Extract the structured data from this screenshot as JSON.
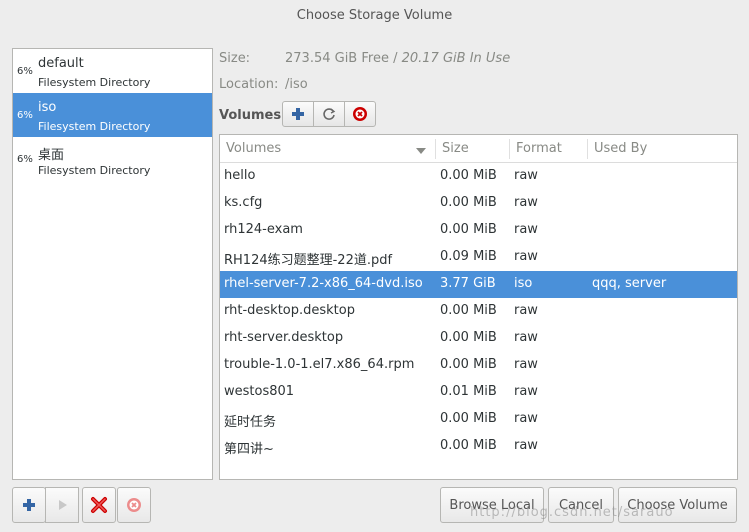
{
  "window": {
    "title": "Choose Storage Volume"
  },
  "pools": [
    {
      "percent": "6%",
      "name": "default",
      "type": "Filesystem Directory"
    },
    {
      "percent": "6%",
      "name": "iso",
      "type": "Filesystem Directory"
    },
    {
      "percent": "6%",
      "name": "桌面",
      "type": "Filesystem Directory"
    }
  ],
  "info": {
    "size_label": "Size:",
    "size_free": "273.54 GiB Free",
    "size_sep": " / ",
    "size_in_use": "20.17 GiB In Use",
    "location_label": "Location:",
    "location_value": "/iso"
  },
  "volumes_label": "Volumes",
  "table": {
    "columns": [
      "Volumes",
      "Size",
      "Format",
      "Used By"
    ],
    "rows": [
      {
        "name": "hello",
        "size": "0.00 MiB",
        "format": "raw",
        "used_by": ""
      },
      {
        "name": "ks.cfg",
        "size": "0.00 MiB",
        "format": "raw",
        "used_by": ""
      },
      {
        "name": "rh124-exam",
        "size": "0.00 MiB",
        "format": "raw",
        "used_by": ""
      },
      {
        "name": "RH124练习题整理-22道.pdf",
        "size": "0.09 MiB",
        "format": "raw",
        "used_by": ""
      },
      {
        "name": "rhel-server-7.2-x86_64-dvd.iso",
        "size": "3.77 GiB",
        "format": "iso",
        "used_by": "qqq, server"
      },
      {
        "name": "rht-desktop.desktop",
        "size": "0.00 MiB",
        "format": "raw",
        "used_by": ""
      },
      {
        "name": "rht-server.desktop",
        "size": "0.00 MiB",
        "format": "raw",
        "used_by": ""
      },
      {
        "name": "trouble-1.0-1.el7.x86_64.rpm",
        "size": "0.00 MiB",
        "format": "raw",
        "used_by": ""
      },
      {
        "name": "westos801",
        "size": "0.01 MiB",
        "format": "raw",
        "used_by": ""
      },
      {
        "name": "延时任务",
        "size": "0.00 MiB",
        "format": "raw",
        "used_by": ""
      },
      {
        "name": "第四讲~",
        "size": "0.00 MiB",
        "format": "raw",
        "used_by": ""
      }
    ]
  },
  "buttons": {
    "browse_local": "Browse Local",
    "cancel": "Cancel",
    "choose_volume": "Choose Volume"
  },
  "watermark": "http://blog.csdn.net/sarauo",
  "colors": {
    "selection": "#4a90d9",
    "add": "#3465a4",
    "delete": "#cc0000"
  }
}
